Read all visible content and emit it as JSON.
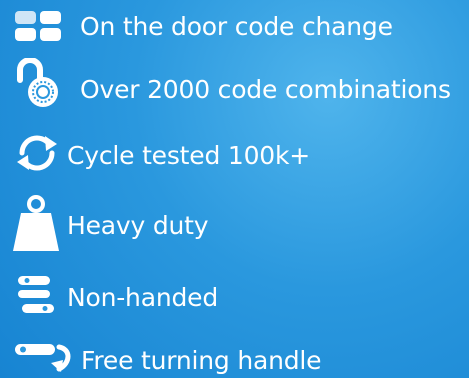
{
  "features": [
    {
      "label": "On the door code change",
      "icon": "keypad-icon"
    },
    {
      "label": "Over 2000 code combinations",
      "icon": "combination-padlock-icon"
    },
    {
      "label": "Cycle tested 100k+",
      "icon": "cycle-arrows-icon"
    },
    {
      "label": "Heavy duty",
      "icon": "weight-icon"
    },
    {
      "label": "Non-handed",
      "icon": "reversible-handle-icon"
    },
    {
      "label": "Free turning handle",
      "icon": "turning-handle-icon"
    }
  ],
  "colors": {
    "background_light": "#4fb4ec",
    "background_dark": "#1784d2",
    "foreground": "#ffffff"
  }
}
